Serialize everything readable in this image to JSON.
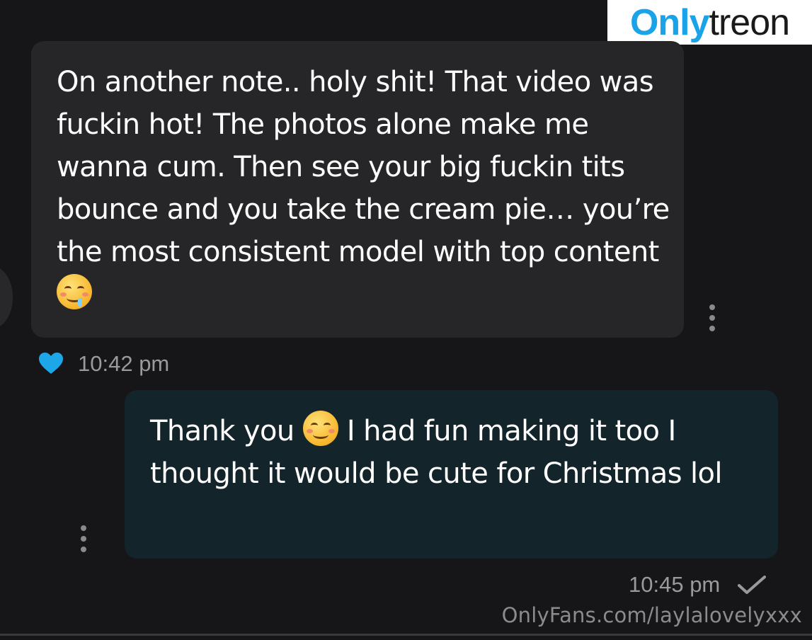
{
  "logo": {
    "part1": "Only",
    "part2": "treon"
  },
  "messages": [
    {
      "direction": "incoming",
      "text_before_emoji": "On another note.. holy shit! That video was fuckin hot! The photos alone make me wanna cum. Then see your big fuckin tits bounce and you take the cream pie… you’re the most consistent model with top content ",
      "emoji": "drooling-face",
      "text_after_emoji": "",
      "time": "10:42 pm",
      "liked": true
    },
    {
      "direction": "outgoing",
      "text_before_emoji": "Thank you ",
      "emoji": "smiling-face",
      "text_after_emoji": " I had fun making it too I thought it would be cute for Christmas lol",
      "time": "10:45 pm",
      "status": "sent"
    }
  ],
  "watermark": "OnlyFans.com/laylalovelyxxx",
  "colors": {
    "background": "#161618",
    "incoming_bubble": "#262628",
    "outgoing_bubble": "#13252b",
    "heart": "#1ea7e8",
    "meta_text": "#9a9a9e"
  }
}
